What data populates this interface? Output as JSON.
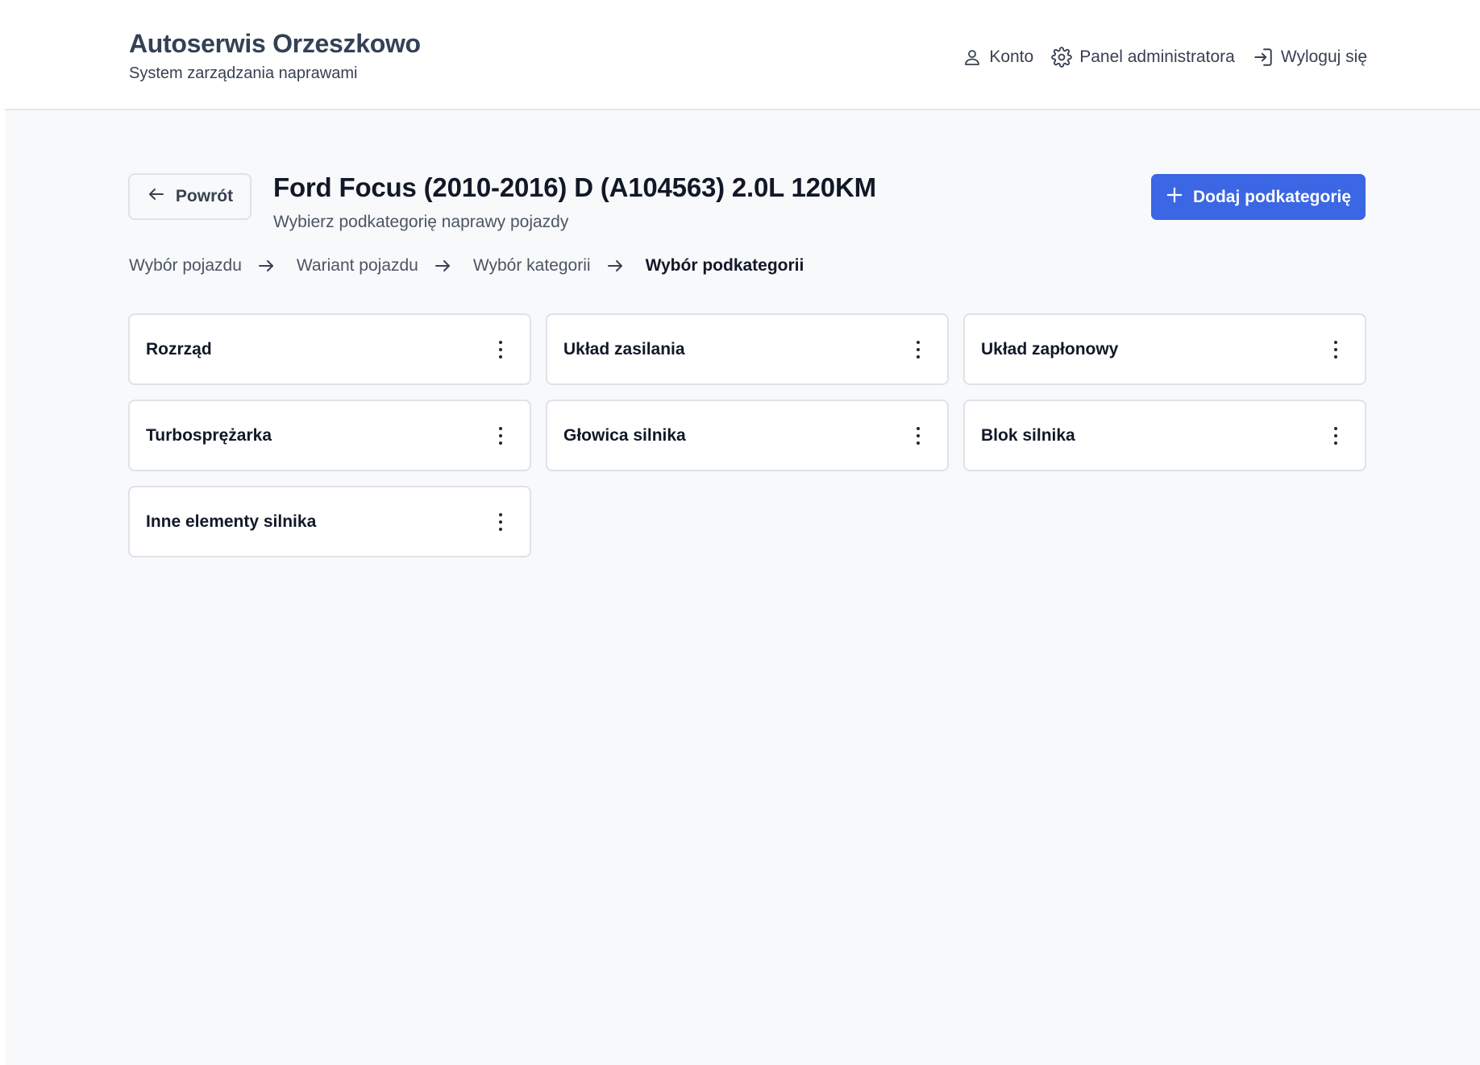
{
  "header": {
    "title": "Autoserwis Orzeszkowo",
    "subtitle": "System zarządzania naprawami",
    "nav": [
      {
        "label": "Konto",
        "icon": "user-icon"
      },
      {
        "label": "Panel administratora",
        "icon": "gear-icon"
      },
      {
        "label": "Wyloguj się",
        "icon": "logout-icon"
      }
    ]
  },
  "page": {
    "back_label": "Powrót",
    "title": "Ford Focus (2010-2016) D (A104563) 2.0L 120KM",
    "subtitle": "Wybierz podkategorię naprawy pojazdy",
    "add_label": "Dodaj podkategorię"
  },
  "breadcrumb": [
    "Wybór pojazdu",
    "Wariant pojazdu",
    "Wybór kategorii",
    "Wybór podkategorii"
  ],
  "subcategories": [
    "Rozrząd",
    "Układ zasilania",
    "Układ zapłonowy",
    "Turbosprężarka",
    "Głowica silnika",
    "Blok silnika",
    "Inne elementy silnika"
  ],
  "colors": {
    "accent": "#3b66e4",
    "background": "#f8f9fb",
    "card_border": "#dfe2e7"
  }
}
